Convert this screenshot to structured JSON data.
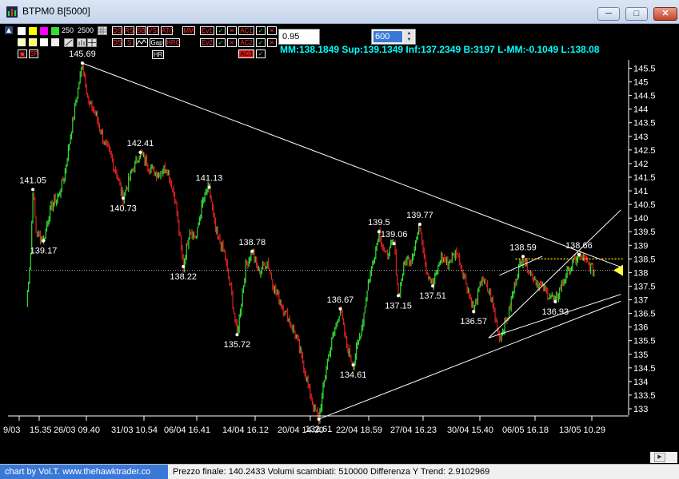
{
  "window": {
    "title": "BTPM0 B[5000]",
    "minimize": "─",
    "maximize": "□",
    "close": "✕"
  },
  "toolbar": {
    "value_250": "250",
    "value_2500": "2500",
    "buttons": [
      {
        "label": "DS",
        "color": "#d01818"
      },
      {
        "label": "RS",
        "color": "#d01818"
      },
      {
        "label": "BB",
        "color": "#d01818"
      },
      {
        "label": "VSI",
        "color": "#d01818"
      },
      {
        "label": "ATC",
        "color": "#d01818"
      },
      {
        "label": "Gap",
        "color": "#ffffff"
      },
      {
        "label": "HR",
        "color": "#ffffff"
      },
      {
        "label": "MM",
        "color": "#d01818"
      },
      {
        "label": "Ev1",
        "color": "#d01818"
      },
      {
        "label": "Ev2",
        "color": "#d01818"
      },
      {
        "label": "AC1",
        "color": "#d01818"
      },
      {
        "label": "AC2",
        "color": "#d01818"
      },
      {
        "label": "AC3",
        "color": "#d01818"
      },
      {
        "label": "SP",
        "color": "#d01818"
      }
    ],
    "input_value": "0.95",
    "bars_value": "600"
  },
  "stats": {
    "text": "MM:138.1849 Sup:139.1349 Inf:137.2349 B:3197 L-MM:-0.1049 L:138.08"
  },
  "status": {
    "credit": "chart by Vol.T. www.thehawktrader.co",
    "text": "Prezzo finale: 140.2433 Volumi scambiati: 510000 Differenza Y Trend: 2.9102969"
  },
  "chart_data": {
    "type": "candlestick",
    "y_ticks": [
      "145.5",
      "145",
      "144.5",
      "144",
      "143.5",
      "143",
      "142.5",
      "142",
      "141.5",
      "141",
      "140.5",
      "140",
      "139.5",
      "139",
      "138.5",
      "138",
      "137.5",
      "137",
      "136.5",
      "136",
      "135.5",
      "135",
      "134.5",
      "134",
      "133.5",
      "133"
    ],
    "x_ticks": [
      "9/03",
      "15.35",
      "26/03 09.40",
      "31/03 10.54",
      "06/04 16.41",
      "14/04 16.12",
      "20/04 14.30",
      "22/04 18.59",
      "27/04 16.23",
      "30/04 15.40",
      "06/05 16.18",
      "13/05 10.29"
    ],
    "ylim": [
      132.8,
      145.9
    ],
    "n_bars": 600,
    "path": [
      [
        0,
        136.8
      ],
      [
        4,
        138.7
      ],
      [
        6,
        141.05
      ],
      [
        9,
        139.5
      ],
      [
        16,
        139.17
      ],
      [
        20,
        140.0
      ],
      [
        24,
        140.5
      ],
      [
        30,
        140.8
      ],
      [
        36,
        141.7
      ],
      [
        42,
        143.3
      ],
      [
        47,
        144.5
      ],
      [
        52,
        145.69
      ],
      [
        58,
        144.2
      ],
      [
        64,
        143.9
      ],
      [
        72,
        142.8
      ],
      [
        78,
        142.3
      ],
      [
        84,
        141.6
      ],
      [
        90,
        140.73
      ],
      [
        98,
        141.7
      ],
      [
        106,
        142.41
      ],
      [
        114,
        141.9
      ],
      [
        122,
        141.6
      ],
      [
        130,
        141.9
      ],
      [
        138,
        140.8
      ],
      [
        146,
        138.22
      ],
      [
        152,
        139.6
      ],
      [
        158,
        139.3
      ],
      [
        164,
        140.6
      ],
      [
        170,
        141.13
      ],
      [
        176,
        139.5
      ],
      [
        184,
        138.7
      ],
      [
        190,
        137.4
      ],
      [
        196,
        135.72
      ],
      [
        204,
        138.2
      ],
      [
        210,
        138.78
      ],
      [
        216,
        138.0
      ],
      [
        224,
        138.4
      ],
      [
        230,
        137.5
      ],
      [
        236,
        136.9
      ],
      [
        244,
        136.3
      ],
      [
        252,
        135.5
      ],
      [
        260,
        134.2
      ],
      [
        266,
        133.2
      ],
      [
        272,
        132.62
      ],
      [
        280,
        134.8
      ],
      [
        286,
        135.8
      ],
      [
        292,
        136.67
      ],
      [
        298,
        135.3
      ],
      [
        304,
        134.61
      ],
      [
        312,
        136.0
      ],
      [
        318,
        137.6
      ],
      [
        324,
        138.7
      ],
      [
        328,
        139.5
      ],
      [
        334,
        138.6
      ],
      [
        342,
        139.06
      ],
      [
        346,
        137.15
      ],
      [
        352,
        138.4
      ],
      [
        358,
        138.5
      ],
      [
        366,
        139.77
      ],
      [
        372,
        138.1
      ],
      [
        378,
        137.51
      ],
      [
        386,
        138.6
      ],
      [
        392,
        138.3
      ],
      [
        400,
        138.8
      ],
      [
        408,
        137.8
      ],
      [
        416,
        136.57
      ],
      [
        424,
        137.8
      ],
      [
        432,
        137.1
      ],
      [
        440,
        135.6
      ],
      [
        448,
        136.4
      ],
      [
        456,
        137.9
      ],
      [
        462,
        138.59
      ],
      [
        470,
        137.9
      ],
      [
        478,
        137.5
      ],
      [
        486,
        137.2
      ],
      [
        492,
        136.93
      ],
      [
        498,
        137.6
      ],
      [
        506,
        138.2
      ],
      [
        514,
        138.66
      ],
      [
        520,
        138.4
      ],
      [
        528,
        138.08
      ]
    ],
    "labels": [
      {
        "text": "145.69",
        "i": 52,
        "y": 145.69,
        "pos": "above"
      },
      {
        "text": "141.05",
        "i": 6,
        "y": 141.05,
        "pos": "above"
      },
      {
        "text": "139.17",
        "i": 16,
        "y": 139.17,
        "pos": "below"
      },
      {
        "text": "142.41",
        "i": 106,
        "y": 142.41,
        "pos": "above"
      },
      {
        "text": "140.73",
        "i": 90,
        "y": 140.73,
        "pos": "below"
      },
      {
        "text": "141.13",
        "i": 170,
        "y": 141.13,
        "pos": "above"
      },
      {
        "text": "138.22",
        "i": 146,
        "y": 138.22,
        "pos": "below"
      },
      {
        "text": "138.78",
        "i": 210,
        "y": 138.78,
        "pos": "above"
      },
      {
        "text": "135.72",
        "i": 196,
        "y": 135.72,
        "pos": "below"
      },
      {
        "text": "132.61",
        "i": 272,
        "y": 132.62,
        "pos": "below"
      },
      {
        "text": "136.67",
        "i": 292,
        "y": 136.67,
        "pos": "above"
      },
      {
        "text": "134.61",
        "i": 304,
        "y": 134.61,
        "pos": "below"
      },
      {
        "text": "139.5",
        "i": 328,
        "y": 139.5,
        "pos": "above"
      },
      {
        "text": "139.06",
        "i": 342,
        "y": 139.06,
        "pos": "above"
      },
      {
        "text": "137.15",
        "i": 346,
        "y": 137.15,
        "pos": "below"
      },
      {
        "text": "139.77",
        "i": 366,
        "y": 139.77,
        "pos": "above"
      },
      {
        "text": "137.51",
        "i": 378,
        "y": 137.51,
        "pos": "below"
      },
      {
        "text": "136.57",
        "i": 416,
        "y": 136.57,
        "pos": "below"
      },
      {
        "text": "138.59",
        "i": 462,
        "y": 138.59,
        "pos": "above"
      },
      {
        "text": "136.93",
        "i": 492,
        "y": 136.93,
        "pos": "below"
      },
      {
        "text": "138.66",
        "i": 514,
        "y": 138.66,
        "pos": "above"
      }
    ],
    "trendlines": [
      {
        "from": [
          52,
          145.69
        ],
        "to": [
          553,
          138.2
        ],
        "color": "#ffffff"
      },
      {
        "from": [
          272,
          132.62
        ],
        "to": [
          553,
          136.95
        ],
        "color": "#ffffff"
      },
      {
        "from": [
          430,
          135.6
        ],
        "to": [
          553,
          140.3
        ],
        "color": "#ffffff"
      },
      {
        "from": [
          430,
          135.6
        ],
        "to": [
          553,
          137.2
        ],
        "color": "#ffffff"
      },
      {
        "from": [
          440,
          137.9
        ],
        "to": [
          480,
          138.6
        ],
        "color": "#ffffff"
      }
    ],
    "mm_level": 138.08,
    "support_level": 138.5,
    "up_color": "#33dd33",
    "down_color": "#e02020",
    "grid": false
  }
}
